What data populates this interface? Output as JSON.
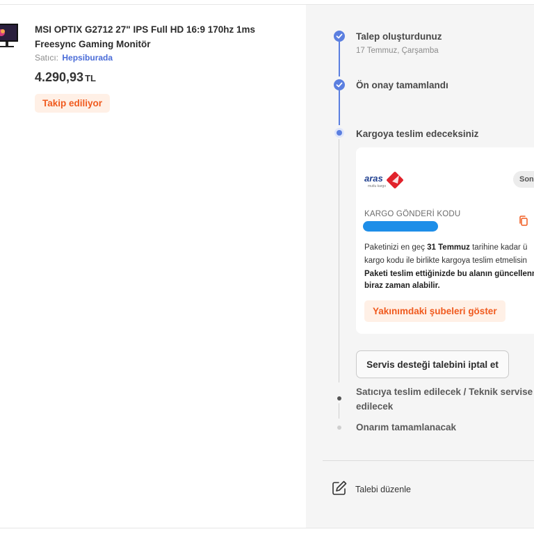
{
  "product": {
    "title": "MSI OPTIX G2712 27\" IPS Full HD 16:9 170hz 1ms Freesync Gaming Monitör",
    "seller_label": "Satıcı:",
    "seller_name": "Hepsiburada",
    "price_amount": "4.290,93",
    "price_currency": "TL",
    "status_badge": "Takip ediliyor"
  },
  "timeline": {
    "steps": [
      {
        "title": "Talep oluşturdunuz",
        "date": "17 Temmuz, Çarşamba",
        "state": "done"
      },
      {
        "title": "Ön onay tamamlandı",
        "state": "done"
      },
      {
        "title": "Kargoya teslim edeceksiniz",
        "state": "current"
      },
      {
        "title": "Satıcıya teslim edilecek / Teknik servise gönderilecek",
        "title_line1": "Satıcıya teslim edilecek / Teknik servise",
        "title_line2": "edilecek",
        "state": "upcoming"
      },
      {
        "title": "Onarım tamamlanacak",
        "state": "upcoming"
      }
    ]
  },
  "cargo_card": {
    "carrier_logo_text": "aras",
    "carrier_slogan": "mutlu kargo",
    "last_chip": "Son",
    "code_label": "KARGO GÖNDERİ KODU",
    "instructions": {
      "line1_pre": "Paketinizi en geç ",
      "line1_date": "31 Temmuz",
      "line1_post": " tarihine kadar ü",
      "line2": "kargo kodu ile birlikte kargoya teslim etmelisin",
      "line3_bold": "Paketi teslim ettiğinizde bu alanın güncellenm",
      "line4_bold": "biraz zaman alabilir."
    },
    "branches_button": "Yakınımdaki şubeleri göster"
  },
  "cancel_button": "Servis desteği talebini iptal et",
  "edit_request_label": "Talebi düzenle",
  "colors": {
    "accent_blue": "#5b7fe0",
    "accent_orange": "#f05a1e",
    "badge_bg": "#fff0e6",
    "right_panel_bg": "#f5f5f5"
  }
}
